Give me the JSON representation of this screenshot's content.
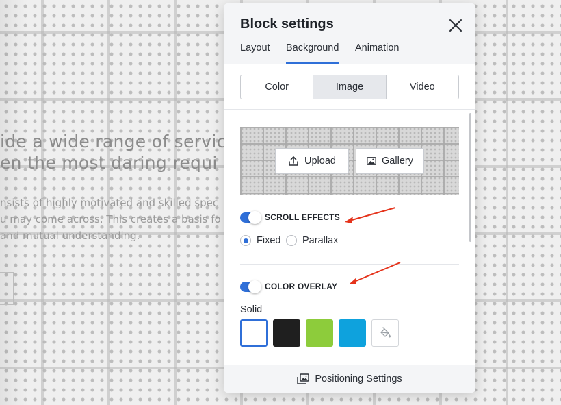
{
  "background": {
    "heading_lines": [
      "ide a wide range of servic",
      "en the most daring requi"
    ],
    "paragraph_lines": [
      "nsists of highly motivated and skilled spec",
      "u may come across. This creates a basis fo",
      "and mutual understanding."
    ]
  },
  "panel": {
    "title": "Block settings",
    "tabs": [
      {
        "label": "Layout",
        "active": false
      },
      {
        "label": "Background",
        "active": true
      },
      {
        "label": "Animation",
        "active": false
      }
    ],
    "background_types": [
      {
        "label": "Color",
        "active": false
      },
      {
        "label": "Image",
        "active": true
      },
      {
        "label": "Video",
        "active": false
      }
    ],
    "upload_label": "Upload",
    "gallery_label": "Gallery",
    "scroll_effects": {
      "label": "SCROLL EFFECTS",
      "enabled": true,
      "options": [
        {
          "label": "Fixed",
          "checked": true
        },
        {
          "label": "Parallax",
          "checked": false
        }
      ]
    },
    "color_overlay": {
      "label": "COLOR OVERLAY",
      "enabled": true,
      "solid_label": "Solid",
      "swatches": [
        {
          "color": "#ffffff",
          "selected": true
        },
        {
          "color": "#1f1f1f",
          "selected": false
        },
        {
          "color": "#8dcc3b",
          "selected": false
        },
        {
          "color": "#0ea2dd",
          "selected": false
        }
      ]
    },
    "footer_label": "Positioning Settings"
  },
  "colors": {
    "accent": "#2f6fd8",
    "annotation_arrow": "#e5331b"
  }
}
